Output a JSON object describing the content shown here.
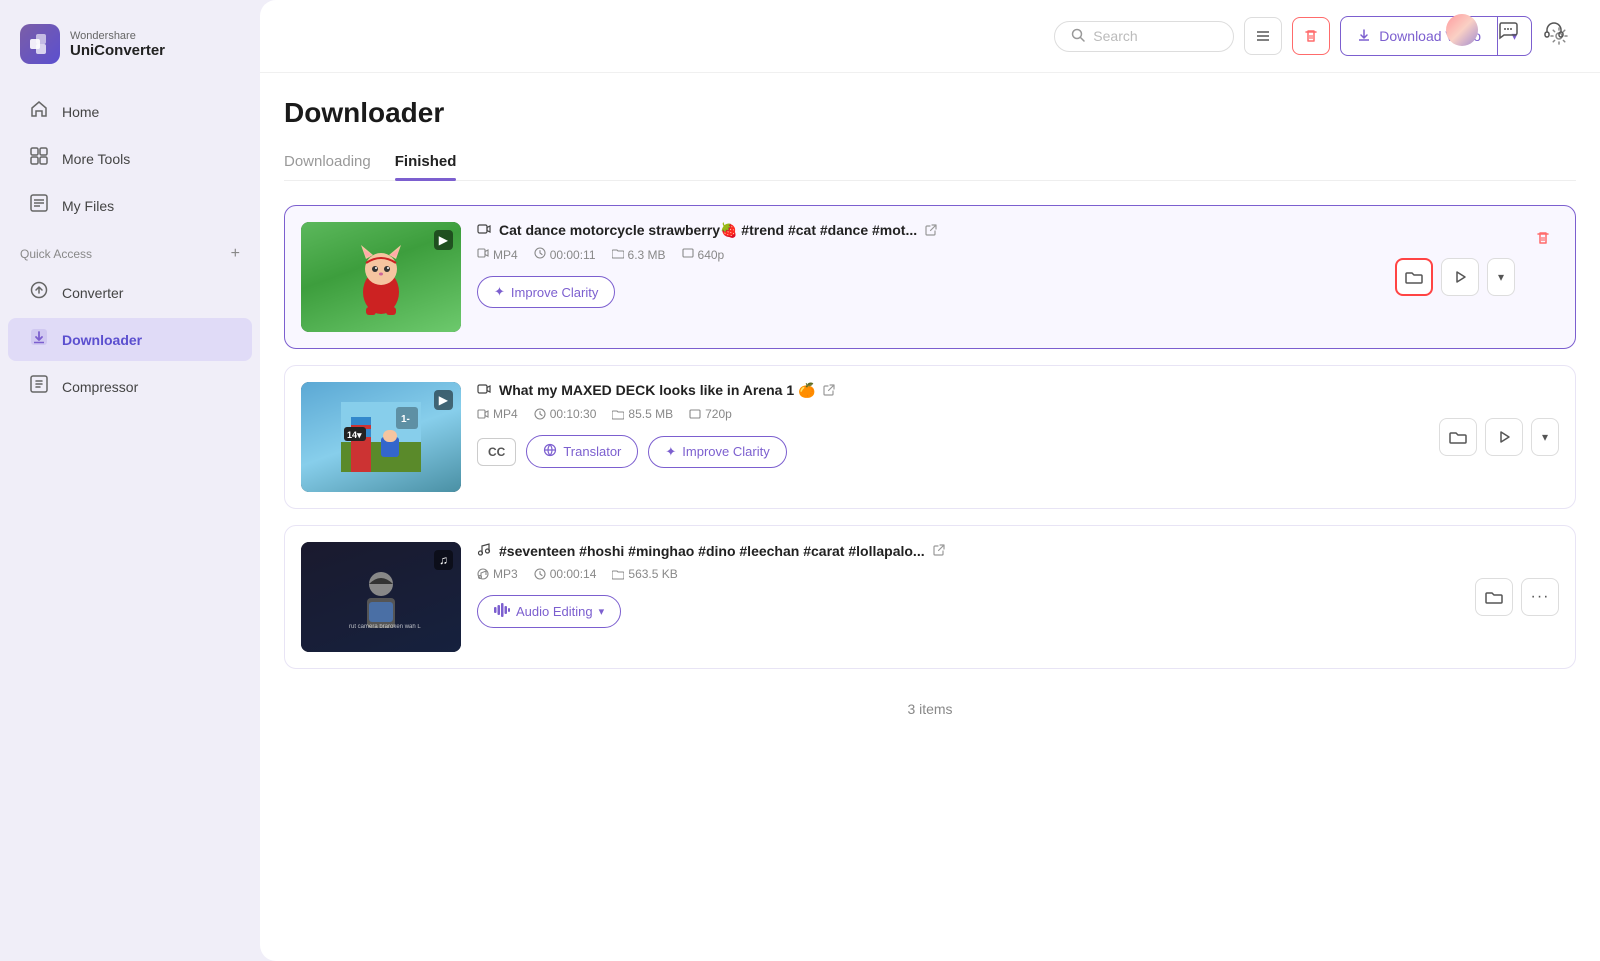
{
  "app": {
    "brand": "Wondershare",
    "product": "UniConverter"
  },
  "window_controls": {
    "close": "close",
    "minimize": "minimize",
    "maximize": "maximize"
  },
  "sidebar": {
    "nav_items": [
      {
        "id": "home",
        "label": "Home",
        "icon": "⌂",
        "active": false
      },
      {
        "id": "more-tools",
        "label": "More Tools",
        "icon": "⊞",
        "active": false
      },
      {
        "id": "my-files",
        "label": "My Files",
        "icon": "☰",
        "active": false
      }
    ],
    "quick_access_label": "Quick Access",
    "quick_access_items": [
      {
        "id": "converter",
        "label": "Converter",
        "icon": "⟳",
        "active": false
      },
      {
        "id": "downloader",
        "label": "Downloader",
        "icon": "⬇",
        "active": true
      },
      {
        "id": "compressor",
        "label": "Compressor",
        "icon": "⊡",
        "active": false
      }
    ]
  },
  "topbar": {
    "search_placeholder": "Search",
    "download_video_label": "Download Video",
    "settings_icon": "⚙"
  },
  "page": {
    "title": "Downloader",
    "tabs": [
      {
        "id": "downloading",
        "label": "Downloading",
        "active": false
      },
      {
        "id": "finished",
        "label": "Finished",
        "active": true
      }
    ]
  },
  "media_items": [
    {
      "id": "item1",
      "type": "video",
      "title": "Cat dance motorcycle strawberry🍓 #trend #cat #dance #mot...",
      "format": "MP4",
      "duration": "00:00:11",
      "size": "6.3 MB",
      "resolution": "640p",
      "selected": true,
      "buttons": [
        {
          "id": "improve-clarity-1",
          "label": "Improve Clarity",
          "type": "outline-purple"
        }
      ],
      "thumb_type": "cat"
    },
    {
      "id": "item2",
      "type": "video",
      "title": "What my MAXED DECK looks like in Arena 1 🍊",
      "format": "MP4",
      "duration": "00:10:30",
      "size": "85.5 MB",
      "resolution": "720p",
      "selected": false,
      "buttons": [
        {
          "id": "translator-2",
          "label": "Translator",
          "type": "outline-purple"
        },
        {
          "id": "improve-clarity-2",
          "label": "Improve Clarity",
          "type": "outline-purple"
        }
      ],
      "has_cc": true,
      "thumb_type": "game"
    },
    {
      "id": "item3",
      "type": "audio",
      "title": "#seventeen #hoshi #minghao #dino #leechan #carat #lollapalo...",
      "format": "MP3",
      "duration": "00:00:14",
      "size": "563.5 KB",
      "resolution": null,
      "selected": false,
      "buttons": [
        {
          "id": "audio-editing-3",
          "label": "Audio Editing",
          "type": "outline-purple"
        }
      ],
      "thumb_type": "audio"
    }
  ],
  "footer": {
    "items_count": "3 items"
  },
  "icons": {
    "search": "🔍",
    "list_view": "≡",
    "delete": "🗑",
    "download_arrow": "⬇",
    "chevron_down": "▾",
    "folder": "🗂",
    "convert": "▶",
    "more": "…",
    "link": "↗",
    "video_cam": "📹",
    "music_note": "♫",
    "clock": "◷",
    "file": "📁",
    "resolution": "⬜",
    "wand": "✦",
    "translate": "⟲"
  }
}
